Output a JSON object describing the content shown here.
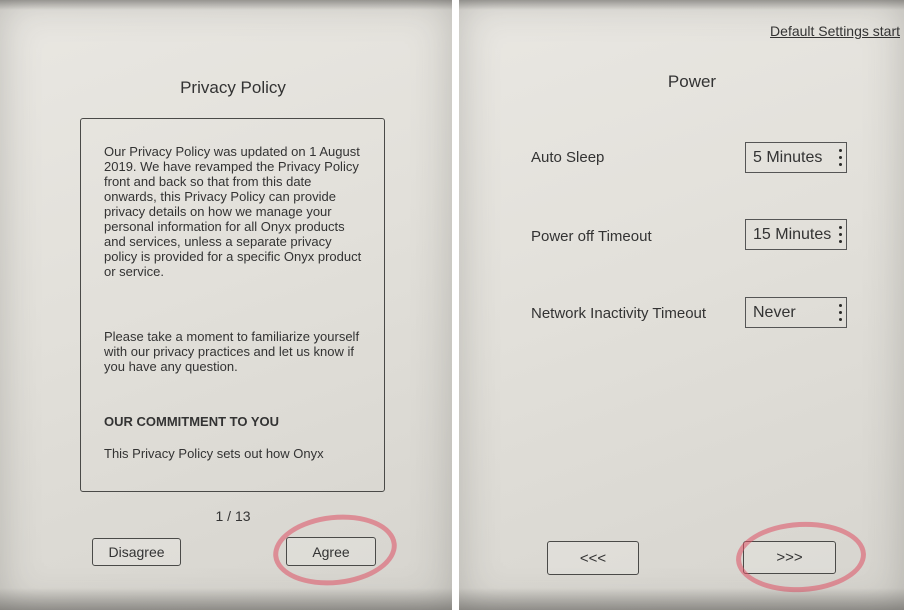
{
  "privacy": {
    "title": "Privacy Policy",
    "para1": "Our Privacy Policy was updated on 1 August 2019. We have revamped the Privacy Policy front and back so that from this date onwards, this Privacy Policy can provide privacy details on how we manage your personal information for all Onyx products and services, unless a separate privacy policy is provided for a specific Onyx product or service.",
    "para2": "Please take a moment to familiarize yourself with our privacy practices and let us know if you have any question.",
    "heading": "OUR COMMITMENT TO YOU",
    "para3": "This Privacy Policy sets out how Onyx",
    "page_indicator": "1 / 13",
    "disagree_label": "Disagree",
    "agree_label": "Agree"
  },
  "power": {
    "default_settings_link": "Default Settings start",
    "title": "Power",
    "settings": [
      {
        "label": "Auto Sleep",
        "value": "5 Minutes"
      },
      {
        "label": "Power off Timeout",
        "value": "15 Minutes"
      },
      {
        "label": "Network Inactivity Timeout",
        "value": "Never"
      }
    ],
    "prev_label": "<<<",
    "next_label": ">>>"
  },
  "colors": {
    "screen": "#e4e2dc",
    "ink": "#2a2a28",
    "marker": "#de5064"
  }
}
